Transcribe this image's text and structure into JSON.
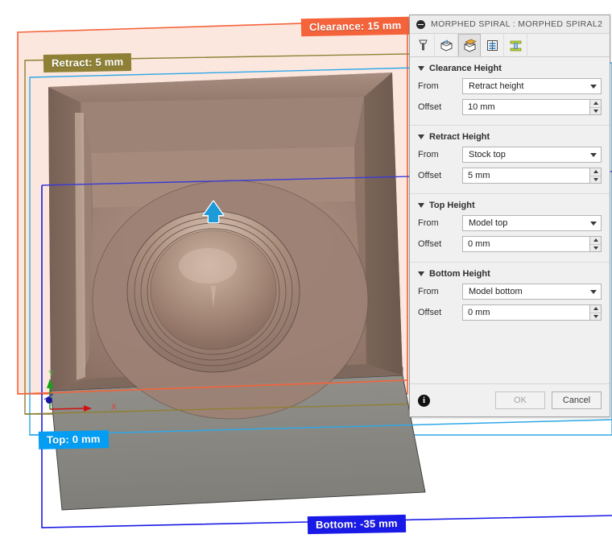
{
  "viewport": {
    "badges": [
      {
        "key": "clearance",
        "label": "Clearance: 15 mm",
        "color": "#f4633a"
      },
      {
        "key": "retract",
        "label": "Retract: 5 mm",
        "color": "#8e8034"
      },
      {
        "key": "top",
        "label": "Top: 0 mm",
        "color": "#039ef4"
      },
      {
        "key": "bottom",
        "label": "Bottom: -35 mm",
        "color": "#1a1ae8"
      }
    ],
    "axes": {
      "x_label": "X",
      "y_label": "Y"
    },
    "manipulator": "up-arrow-handle"
  },
  "dialog": {
    "title": "MORPHED SPIRAL : MORPHED SPIRAL2",
    "collapse_icon": "collapse-minus-icon",
    "tabs": [
      {
        "name": "tool",
        "icon": "tool-icon",
        "selected": false
      },
      {
        "name": "geometry",
        "icon": "geometry-icon",
        "selected": false
      },
      {
        "name": "heights",
        "icon": "heights-icon",
        "selected": true
      },
      {
        "name": "passes",
        "icon": "passes-icon",
        "selected": false
      },
      {
        "name": "linking",
        "icon": "linking-icon",
        "selected": false
      }
    ],
    "groups": [
      {
        "title": "Clearance Height",
        "from_label": "From",
        "from_value": "Retract height",
        "offset_label": "Offset",
        "offset_value": "10 mm"
      },
      {
        "title": "Retract Height",
        "from_label": "From",
        "from_value": "Stock top",
        "offset_label": "Offset",
        "offset_value": "5 mm"
      },
      {
        "title": "Top Height",
        "from_label": "From",
        "from_value": "Model top",
        "offset_label": "Offset",
        "offset_value": "0 mm"
      },
      {
        "title": "Bottom Height",
        "from_label": "From",
        "from_value": "Model bottom",
        "offset_label": "Offset",
        "offset_value": "0 mm"
      }
    ],
    "footer": {
      "info_icon": "info-icon",
      "info_glyph": "i",
      "ok_label": "OK",
      "cancel_label": "Cancel",
      "ok_disabled": true
    }
  },
  "colors": {
    "clearance": "#f4633a",
    "retract": "#8e8034",
    "top": "#039ef4",
    "bottom": "#1a1ae8",
    "clearance_fill": "#fce5dc",
    "model": "#8c7365",
    "stock": "#8a8781",
    "dialog_bg": "#f0f0f0"
  }
}
